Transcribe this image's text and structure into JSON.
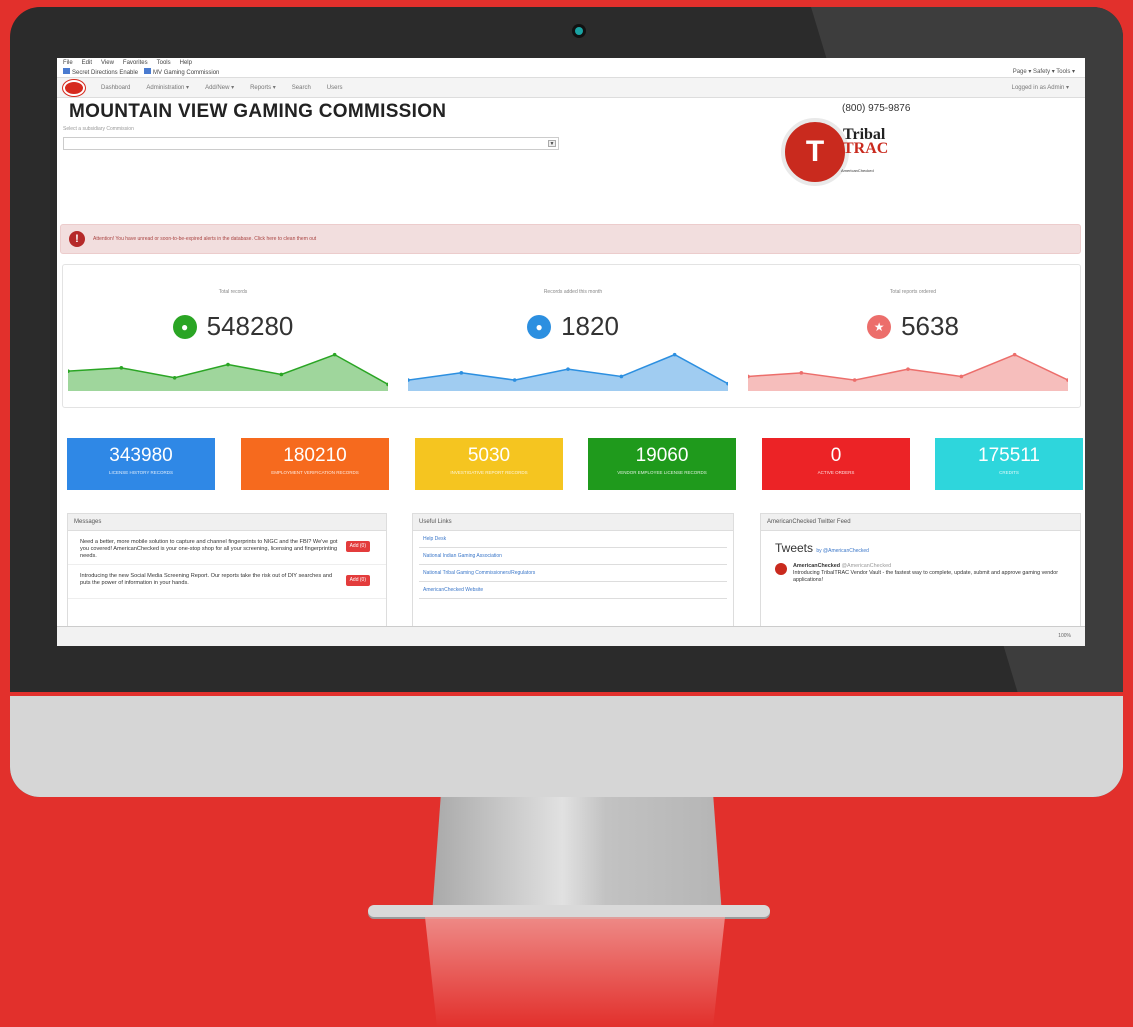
{
  "browser": {
    "menu": [
      "File",
      "Edit",
      "View",
      "Favorites",
      "Tools",
      "Help"
    ],
    "favorites": [
      "Secret Directions Enable",
      "MV Gaming Commission"
    ],
    "tools": "Page ▾  Safety ▾  Tools ▾"
  },
  "appnav": {
    "items": [
      "Dashboard",
      "Administration ▾",
      "Add/New ▾",
      "Reports ▾",
      "Search",
      "Users"
    ],
    "user": "Logged in as Admin ▾"
  },
  "header": {
    "title": "MOUNTAIN VIEW GAMING COMMISSION",
    "subtitle": "Select a subsidiary Commission",
    "phone": "(800) 975-9876",
    "brand_word1": "Tribal",
    "brand_word2": "TRAC",
    "brand_sub": "AmericanChecked",
    "brand_letter": "T"
  },
  "alert": {
    "text": "Attention! You have unread or soon-to-be-expired alerts in the database. Click here to clean them out"
  },
  "stats": [
    {
      "label": "Total records",
      "value": "548280",
      "color": "#2aa524",
      "icon": "person-icon",
      "glyph": "●",
      "series": [
        6,
        7,
        4,
        8,
        5,
        11,
        2
      ]
    },
    {
      "label": "Records added this month",
      "value": "1820",
      "color": "#2c8fe0",
      "icon": "person-icon",
      "glyph": "●",
      "series": [
        3,
        5,
        3,
        6,
        4,
        10,
        2
      ]
    },
    {
      "label": "Total reports ordered",
      "value": "5638",
      "color": "#ec6e6b",
      "icon": "star-icon",
      "glyph": "★",
      "series": [
        4,
        5,
        3,
        6,
        4,
        10,
        3
      ]
    }
  ],
  "tiles": [
    {
      "value": "343980",
      "label": "License History Records",
      "color": "#2f88e6"
    },
    {
      "value": "180210",
      "label": "Employment Verification Records",
      "color": "#f66a1e"
    },
    {
      "value": "5030",
      "label": "Investigative Report Records",
      "color": "#f5c520"
    },
    {
      "value": "19060",
      "label": "Vendor Employee License Records",
      "color": "#1f9a1c"
    },
    {
      "value": "0",
      "label": "Active Orders",
      "color": "#ec2326"
    },
    {
      "value": "175511",
      "label": "Credits",
      "color": "#2ed6dc"
    }
  ],
  "messages": {
    "title": "Messages",
    "button": "Add (0)",
    "items": [
      "Need a better, more mobile solution to capture and channel fingerprints to NIGC and the FBI? We've got you covered! AmericanChecked is your one-stop shop for all your screening, licensing and fingerprinting needs.",
      "Introducing the new Social Media Screening Report. Our reports take the risk out of DIY searches and puts the power of information in your hands."
    ]
  },
  "links": {
    "title": "Useful Links",
    "items": [
      "Help Desk",
      "National Indian Gaming Association",
      "National Tribal Gaming Commissioners/Regulators",
      "AmericanChecked Website"
    ]
  },
  "twitter": {
    "title": "AmericanChecked Twitter Feed",
    "heading": "Tweets",
    "by": "by @AmericanChecked",
    "author": "AmericanChecked",
    "handle": "@AmericanChecked",
    "text": "Introducing TribalTRAC Vendor Vault - the fastest way to complete, update, submit and approve gaming vendor applications!"
  },
  "status": {
    "zoom": "100%"
  }
}
